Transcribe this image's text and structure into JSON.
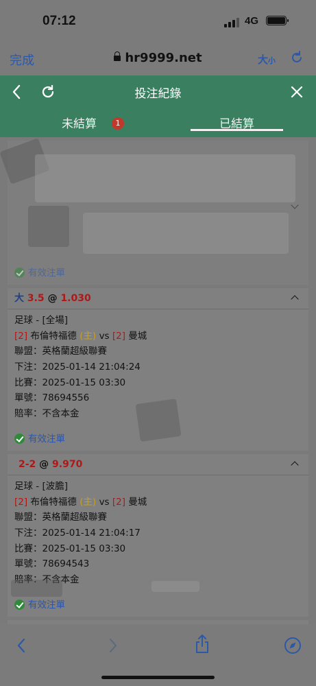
{
  "status_bar": {
    "time": "07:12",
    "network": "4G"
  },
  "browser": {
    "done_label": "完成",
    "url": "hr9999.net",
    "text_size_big": "大",
    "text_size_small": "小"
  },
  "app_header": {
    "title": "投注紀錄"
  },
  "tabs": [
    {
      "label": "未結算",
      "badge": "1",
      "active": false
    },
    {
      "label": "已結算",
      "active": true
    }
  ],
  "bets": [
    {
      "selection": "大",
      "line": "3.5",
      "at": "@",
      "odds": "1.030",
      "market": "足球 - [全場]",
      "team1_tag": "[2]",
      "team1": "布倫特福德",
      "home_tag": "(主)",
      "vs": "vs",
      "team2_tag": "[2]",
      "team2": "曼城",
      "league": "聯盟：英格蘭超級聯賽",
      "placed": "下注：2025-01-14 21:04:24",
      "match": "比賽：2025-01-15 03:30",
      "ticket": "單號：78694556",
      "odds_type": "賠率：不含本金",
      "status": "有效注單"
    },
    {
      "selection": "2-2",
      "at": "@",
      "odds": "9.970",
      "market": "足球 - [波膽]",
      "team1_tag": "[2]",
      "team1": "布倫特福德",
      "home_tag": "(主)",
      "vs": "vs",
      "team2_tag": "[2]",
      "team2": "曼城",
      "league": "聯盟：英格蘭超級聯賽",
      "placed": "下注：2025-01-14 21:04:17",
      "match": "比賽：2025-01-15 03:30",
      "ticket": "單號：78694543",
      "odds_type": "賠率：不含本金",
      "status": "有效注單"
    }
  ],
  "top_card": {
    "status": "有效注單"
  },
  "colors": {
    "header_green": "#3a7f5f",
    "accent_blue": "#2c58a8",
    "odds_red": "#b01717"
  }
}
